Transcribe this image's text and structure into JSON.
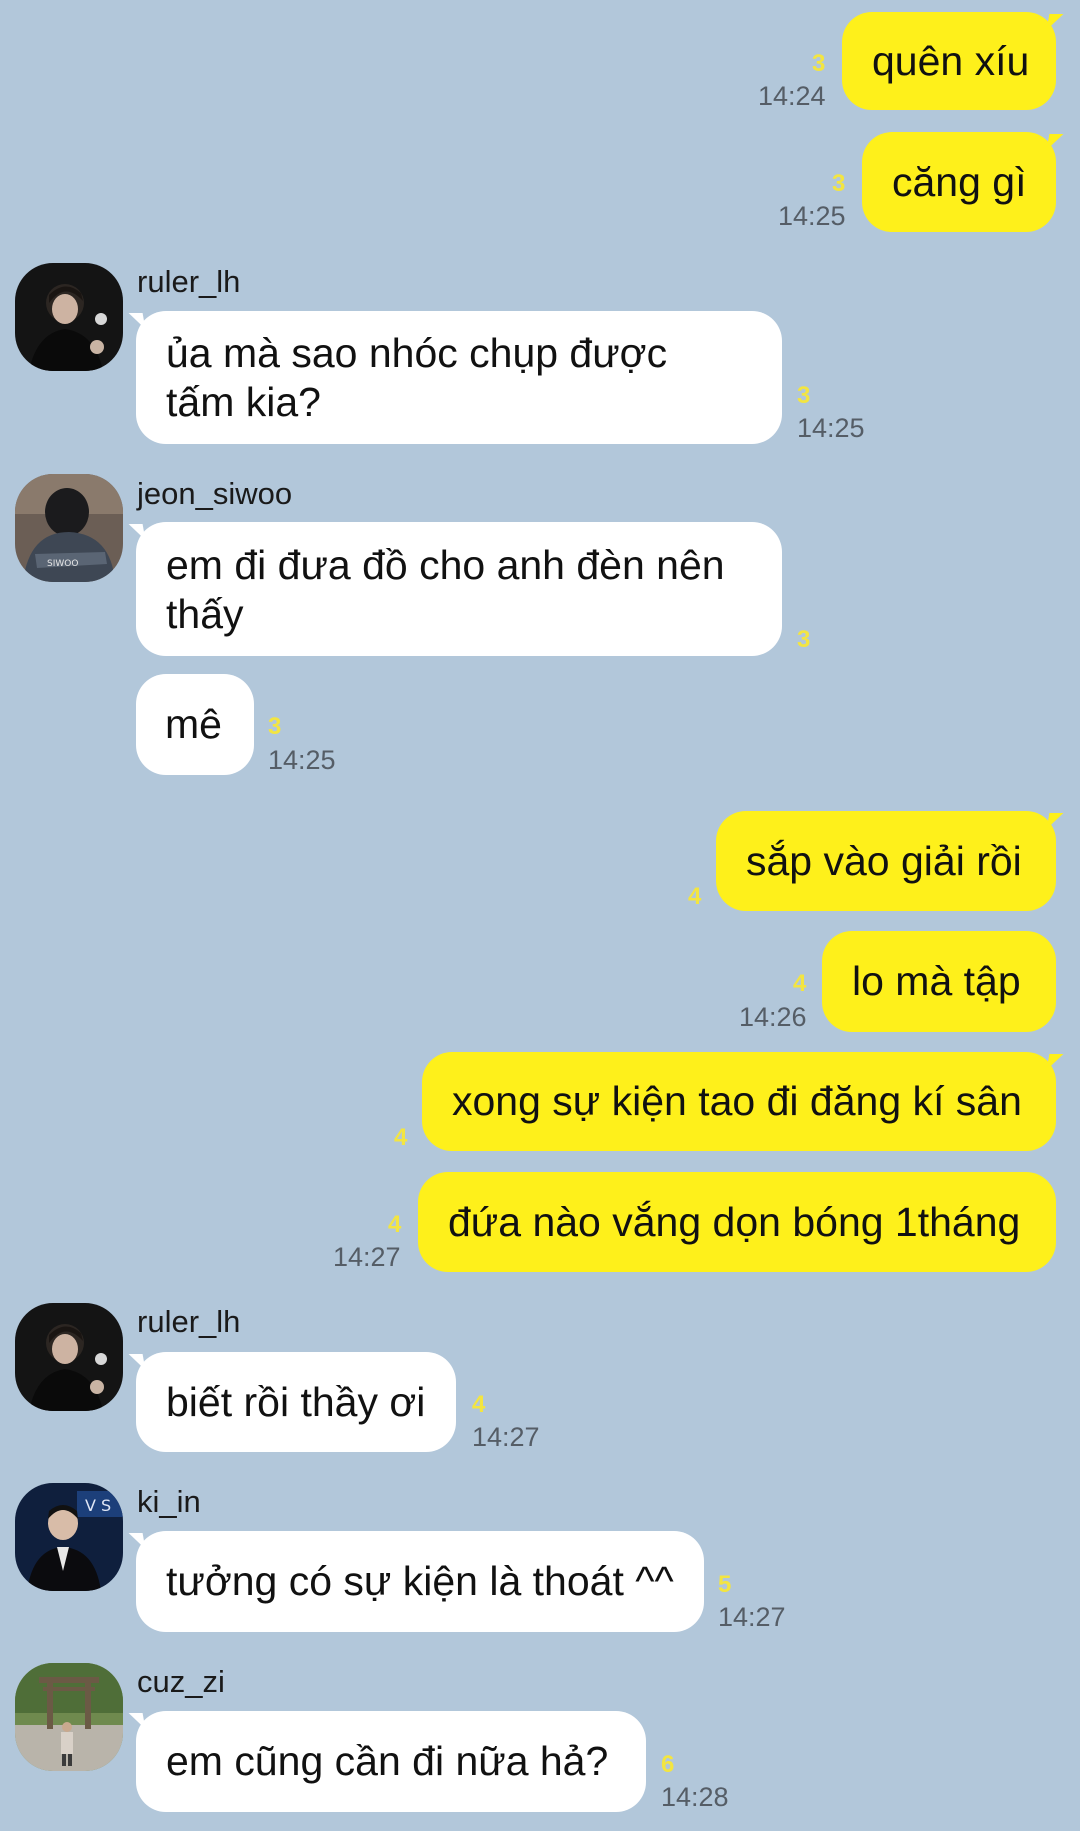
{
  "messages": {
    "m1": {
      "text": "quên xíu",
      "unread": "3",
      "time": "14:24"
    },
    "m2": {
      "text": "căng gì",
      "unread": "3",
      "time": "14:25"
    },
    "m3": {
      "sender": "ruler_lh",
      "text_line1": "ủa mà sao nhóc chụp được",
      "text_line2": "tấm kia?",
      "unread": "3",
      "time": "14:25"
    },
    "m4": {
      "sender": "jeon_siwoo",
      "text_line1": "em đi đưa đồ cho anh đèn nên",
      "text_line2": "thấy",
      "unread": "3"
    },
    "m5": {
      "text": "mê",
      "unread": "3",
      "time": "14:25"
    },
    "m6": {
      "text": "sắp vào giải rồi",
      "unread": "4"
    },
    "m7": {
      "text": "lo mà tập",
      "unread": "4",
      "time": "14:26"
    },
    "m8": {
      "text": "xong sự kiện tao đi đăng kí sân",
      "unread": "4"
    },
    "m9": {
      "text": "đứa nào vắng dọn bóng 1tháng",
      "unread": "4",
      "time": "14:27"
    },
    "m10": {
      "sender": "ruler_lh",
      "text": "biết rồi thầy ơi",
      "unread": "4",
      "time": "14:27"
    },
    "m11": {
      "sender": "ki_in",
      "text": "tưởng có sự kiện là thoát ^^",
      "unread": "5",
      "time": "14:27"
    },
    "m12": {
      "sender": "cuz_zi",
      "text": "em cũng cần đi nữa hả?",
      "unread": "6",
      "time": "14:28"
    }
  },
  "colors": {
    "background": "#b2c7da",
    "my_bubble": "#fef01b",
    "their_bubble": "#ffffff",
    "unread_count": "#f3e541",
    "timestamp": "#555d66"
  },
  "icons": {
    "ruler_lh_avatar": "profile-photo-dark-hoodie",
    "jeon_siwoo_avatar": "profile-photo-jersey",
    "ki_in_avatar": "profile-photo-suit",
    "cuz_zi_avatar": "profile-photo-torii-gate"
  }
}
